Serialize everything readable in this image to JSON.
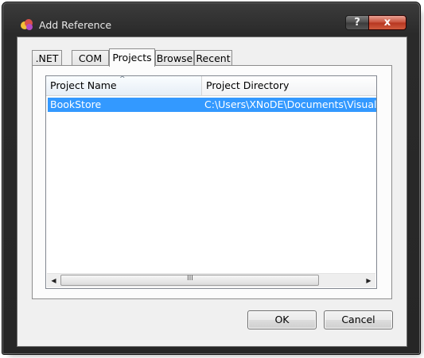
{
  "window": {
    "title": "Add Reference",
    "help_label": "?",
    "close_label": "x"
  },
  "tabs": [
    {
      "label": ".NET"
    },
    {
      "label": "COM"
    },
    {
      "label": "Projects",
      "selected": true
    },
    {
      "label": "Browse"
    },
    {
      "label": "Recent"
    }
  ],
  "list": {
    "columns": [
      {
        "label": "Project Name",
        "sort": "ascending"
      },
      {
        "label": "Project Directory"
      }
    ],
    "rows": [
      {
        "name": "BookStore",
        "directory": "C:\\Users\\XNoDE\\Documents\\Visual Studi",
        "selected": true
      }
    ],
    "sort_glyph": "^",
    "scroll_grip": "III",
    "scroll_left": "◀",
    "scroll_right": "▶"
  },
  "buttons": {
    "ok_label": "OK",
    "cancel_label": "Cancel"
  },
  "colors": {
    "selection": "#3399ff",
    "close_button": "#c8503a"
  }
}
